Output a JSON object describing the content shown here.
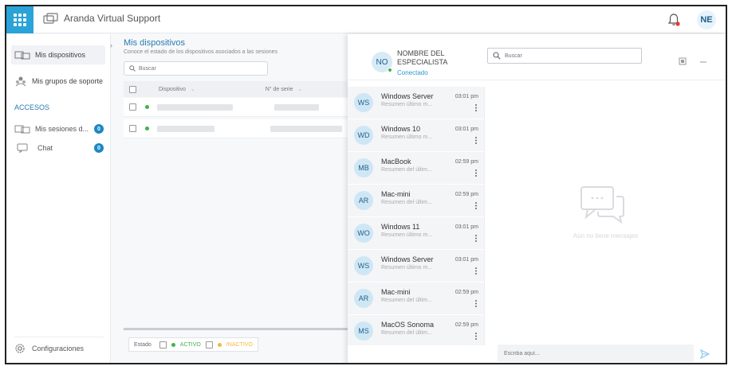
{
  "app": {
    "title": "Aranda Virtual Support",
    "user_initials": "NE",
    "accent": "#29a3d8"
  },
  "sidebar": {
    "items": [
      {
        "label": "Mis dispositivos",
        "icon": "devices-icon"
      },
      {
        "label": "Mis grupos de soporte",
        "icon": "group-icon"
      }
    ],
    "section_title": "ACCESOS",
    "accesos": [
      {
        "label": "Mis sesiones d...",
        "count": "0",
        "icon": "sessions-icon"
      },
      {
        "label": "Chat",
        "count": "0",
        "icon": "chat-icon"
      }
    ],
    "config_label": "Configuraciones"
  },
  "main": {
    "title": "Mis dispositivos",
    "subtitle": "Conoce el estado de los dispositivos asociados a las sesiones",
    "search_placeholder": "Buscar",
    "columns": {
      "device": "Dispositivo",
      "serial": "N° de serie"
    },
    "rows": [
      {
        "status": "activo"
      },
      {
        "status": "activo"
      }
    ],
    "status_filter": {
      "label": "Estado",
      "active": "ACTIVO",
      "inactive": "INACTIVO"
    }
  },
  "chat": {
    "specialist": {
      "initials": "NO",
      "name": "NOMBRE DEL ESPECIALISTA",
      "status": "Conectado"
    },
    "search_placeholder": "Buscar",
    "conversations": [
      {
        "initials": "WS",
        "name": "Windows Server",
        "summary": "Resumen último m...",
        "time": "03:01 pm"
      },
      {
        "initials": "WD",
        "name": "Windows 10",
        "summary": "Resumen último m...",
        "time": "03:01 pm"
      },
      {
        "initials": "MB",
        "name": "MacBook",
        "summary": "Resumen del últim...",
        "time": "02:59 pm"
      },
      {
        "initials": "AR",
        "name": "Mac-mini",
        "summary": "Resumen del últim...",
        "time": "02:59 pm"
      },
      {
        "initials": "WO",
        "name": "Windows 11",
        "summary": "Resumen último m...",
        "time": "03:01 pm"
      },
      {
        "initials": "WS",
        "name": "Windows Server",
        "summary": "Resumen último m...",
        "time": "03:01 pm"
      },
      {
        "initials": "AR",
        "name": "Mac-mini",
        "summary": "Resumen del últim...",
        "time": "02:59 pm"
      },
      {
        "initials": "MS",
        "name": "MacOS Sonoma",
        "summary": "Resumen del últim...",
        "time": "02:59 pm"
      }
    ],
    "empty_message": "Aún no tiene mensajes",
    "compose_placeholder": "Escriba aquí..."
  }
}
